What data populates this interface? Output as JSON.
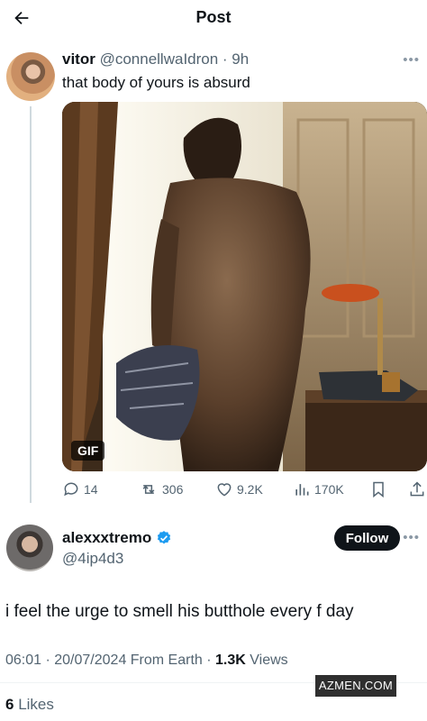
{
  "header": {
    "title": "Post"
  },
  "tweet": {
    "display_name": "vitor",
    "handle": "@connellwaIdron",
    "time": "· 9h",
    "text": "that body of yours is absurd",
    "media_badge": "GIF",
    "stats": {
      "replies": "14",
      "retweets": "306",
      "likes": "9.2K",
      "views": "170K"
    }
  },
  "reply": {
    "display_name": "alexxxtremo",
    "handle": "@4ip4d3",
    "follow_label": "Follow",
    "text": "i feel the urge to smell his butthole every f day",
    "timestamp": "06:01 · 20/07/2024 From Earth · ",
    "views_count": "1.3K",
    "views_label": " Views",
    "likes_count": "6",
    "likes_label": " Likes"
  },
  "watermark": "AZMEN.COM",
  "colors": {
    "verified": "#1d9bf0",
    "text_primary": "#0f1419",
    "text_secondary": "#536471"
  }
}
